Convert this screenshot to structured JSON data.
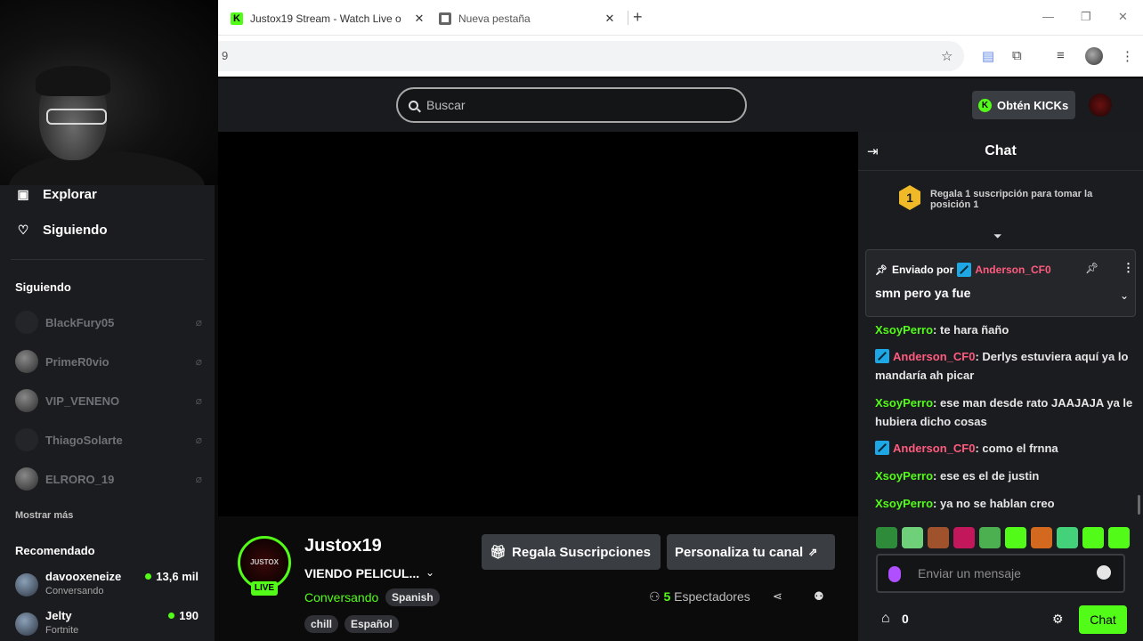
{
  "browser": {
    "tabs": [
      {
        "title": "Justox19 Stream - Watch Live o",
        "icon": "kick-favicon"
      },
      {
        "title": "Nueva pestaña",
        "icon": "chrome-favicon"
      }
    ],
    "url_fragment": "9"
  },
  "header": {
    "search_placeholder": "Buscar",
    "kicks_button": "Obtén KICKs"
  },
  "sidebar": {
    "nav": [
      {
        "label": "Explorar",
        "icon": "explore-icon"
      },
      {
        "label": "Siguiendo",
        "icon": "heart-icon"
      }
    ],
    "following_title": "Siguiendo",
    "following": [
      "BlackFury05",
      "PrimeR0vio",
      "VIP_VENENO",
      "ThiagoSolarte",
      "ELRORO_19"
    ],
    "show_more": "Mostrar más",
    "recommended_title": "Recomendado",
    "recommended": [
      {
        "name": "davooxeneize",
        "category": "Conversando",
        "viewers": "13,6 mil"
      },
      {
        "name": "Jelty",
        "category": "Fortnite",
        "viewers": "190"
      }
    ]
  },
  "channel": {
    "name": "Justox19",
    "avatar_text": "JUSTOX",
    "live_badge": "LIVE",
    "title": "VIENDO PELICUL...",
    "category": "Conversando",
    "language_tag": "Spanish",
    "tags": [
      "chill",
      "Español"
    ],
    "gift_button": "Regala Suscripciones",
    "customize_button": "Personaliza tu canal",
    "viewer_count": "5",
    "viewer_label": "Espectadores"
  },
  "chat": {
    "title": "Chat",
    "promo_rank": "1",
    "promo_text": "Regala 1 suscripción para tomar la posición 1",
    "pinned": {
      "label": "Enviado por",
      "user": "Anderson_CF0",
      "message": "smn pero ya fue"
    },
    "messages": [
      {
        "user": "XsoyPerro",
        "text": ": te hara ñaño",
        "mod": false
      },
      {
        "user": "Anderson_CF0",
        "text": ": Derlys estuviera aquí ya lo mandaría ah picar",
        "mod": true
      },
      {
        "user": "XsoyPerro",
        "text": ": ese man desde rato JAAJAJA ya le hubiera dicho cosas",
        "mod": false
      },
      {
        "user": "Anderson_CF0",
        "text": ": como el frnna",
        "mod": true
      },
      {
        "user": "XsoyPerro",
        "text": ": ese es el de justin",
        "mod": false
      },
      {
        "user": "XsoyPerro",
        "text": ": ya no se hablan creo",
        "mod": false
      }
    ],
    "emote_colors": [
      "#2e8b3a",
      "#6fd07a",
      "#a0522d",
      "#c2185b",
      "#4caf50",
      "#53fc18",
      "#d2691e",
      "#43d17a",
      "#53fc18",
      "#53fc18"
    ],
    "input_placeholder": "Enviar un mensaje",
    "points": "0",
    "send_label": "Chat"
  },
  "colors": {
    "brand": "#53fc18",
    "pink": "#ff5b7f"
  }
}
